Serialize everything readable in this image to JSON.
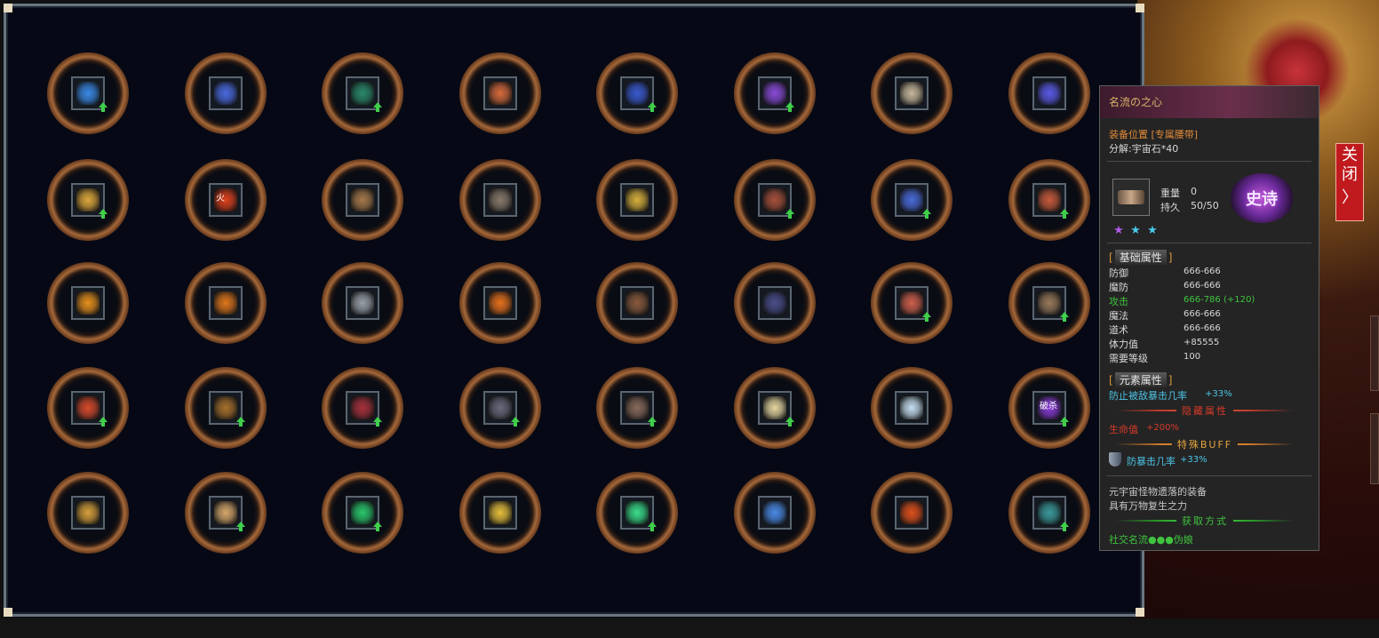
{
  "grid": {
    "columns": 8,
    "rows": 5,
    "slots": [
      {
        "icon": "blue-crystal-wings-icon",
        "color": "#3a8ae6",
        "up": true
      },
      {
        "icon": "blue-sword-icon",
        "color": "#4a6ae0",
        "up": false
      },
      {
        "icon": "green-dragon-icon",
        "color": "#2a8a6a",
        "up": true
      },
      {
        "icon": "fire-pouch-icon",
        "color": "#d86a3a",
        "up": false
      },
      {
        "icon": "blue-whip-icon",
        "color": "#3a5ad0",
        "up": true
      },
      {
        "icon": "purple-armor-icon",
        "color": "#8a4ad8",
        "up": true
      },
      {
        "icon": "scroll-icon",
        "color": "#c8b89a",
        "up": false
      },
      {
        "icon": "blue-ring-icon",
        "color": "#5a5ae6",
        "up": false
      },
      {
        "icon": "gold-tablet-icon",
        "color": "#e0a83a",
        "up": true
      },
      {
        "icon": "fire-orb-icon",
        "color": "#e0401a",
        "up": false
      },
      {
        "icon": "bone-axe-icon",
        "color": "#a87a4a",
        "up": false
      },
      {
        "icon": "dagger-icon",
        "color": "#8a7a6a",
        "up": false
      },
      {
        "icon": "golden-spear-icon",
        "color": "#d8b03a",
        "up": false
      },
      {
        "icon": "red-gun-icon",
        "color": "#a8503a",
        "up": true
      },
      {
        "icon": "blue-gem-boots-icon",
        "color": "#4a6ad8",
        "up": true
      },
      {
        "icon": "red-blade-icon",
        "color": "#c85a3a",
        "up": true
      },
      {
        "icon": "fire-frame-icon",
        "color": "#e8901a",
        "up": false
      },
      {
        "icon": "fire-beast-icon",
        "color": "#e0761a",
        "up": false
      },
      {
        "icon": "silver-staff-icon",
        "color": "#9aa0a8",
        "up": false
      },
      {
        "icon": "flame-square-icon",
        "color": "#e8701a",
        "up": false
      },
      {
        "icon": "helmet-icon",
        "color": "#8a5a3a",
        "up": false
      },
      {
        "icon": "dark-ring-icon",
        "color": "#4a4e8a",
        "up": false
      },
      {
        "icon": "rune-stone-icon",
        "color": "#d0604a",
        "up": true
      },
      {
        "icon": "brown-belt-icon",
        "color": "#9a7a5a",
        "up": true
      },
      {
        "icon": "red-rune-icon",
        "color": "#d84a2a",
        "up": true
      },
      {
        "icon": "bronze-gauntlet-icon",
        "color": "#a8702a",
        "up": true
      },
      {
        "icon": "red-claw-icon",
        "color": "#a8303a",
        "up": true
      },
      {
        "icon": "dark-beast-icon",
        "color": "#6a6a7a",
        "up": true
      },
      {
        "icon": "chain-belt-icon",
        "color": "#8a6a5a",
        "up": true
      },
      {
        "icon": "mask-icon",
        "color": "#e8d8a0",
        "up": true
      },
      {
        "icon": "crystal-icon",
        "color": "#c8e0f0",
        "up": false
      },
      {
        "icon": "purple-orb-icon",
        "color": "#8a3ad8",
        "up": true
      },
      {
        "icon": "gold-crest-icon",
        "color": "#d8a03a",
        "up": false
      },
      {
        "icon": "banner-icon",
        "color": "#d8a86a",
        "up": true
      },
      {
        "icon": "green-gourd-icon",
        "color": "#2ac86a",
        "up": true
      },
      {
        "icon": "gold-sword-icon",
        "color": "#e8c03a",
        "up": false
      },
      {
        "icon": "green-dragon-emblem-icon",
        "color": "#3ae08a",
        "up": true
      },
      {
        "icon": "lightning-spear-icon",
        "color": "#4a8ae6",
        "up": false
      },
      {
        "icon": "fire-gourd-icon",
        "color": "#e0501a",
        "up": false
      },
      {
        "icon": "teal-orb-icon",
        "color": "#3a9a9a",
        "up": true
      }
    ],
    "slot_text": {
      "9": "火",
      "31": "破杀"
    }
  },
  "tooltip": {
    "title": "名流の之心",
    "slot_line": "装备位置 [专属腰带]",
    "decompose_line": "分解:宇宙石*40",
    "weight_label": "重量",
    "weight_value": "0",
    "durability_label": "持久",
    "durability_value": "50/50",
    "badge": "史诗",
    "stars": [
      {
        "glyph": "★",
        "color": "#b05ae8"
      },
      {
        "glyph": "★",
        "color": "#4ac8e8"
      },
      {
        "glyph": "★",
        "color": "#4ac8e8"
      }
    ],
    "base_section": {
      "open": "[",
      "label": "基础属性",
      "close": "]"
    },
    "base_stats": [
      {
        "name": "防御",
        "value": "666-666",
        "color": "#d8d8d8"
      },
      {
        "name": "魔防",
        "value": "666-666",
        "color": "#d8d8d8"
      },
      {
        "name": "攻击",
        "value": "666-786 (+120)",
        "color": "#3fc43f"
      },
      {
        "name": "魔法",
        "value": "666-666",
        "color": "#d8d8d8"
      },
      {
        "name": "道术",
        "value": "666-666",
        "color": "#d8d8d8"
      },
      {
        "name": "体力值",
        "value": "+85555",
        "color": "#d8d8d8"
      },
      {
        "name": "需要等级",
        "value": "100",
        "color": "#d8d8d8"
      }
    ],
    "element_section": {
      "open": "[",
      "label": "元素属性",
      "close": "]"
    },
    "element_stat_name": "防止被敌暴击几率",
    "element_stat_value": "+33%",
    "hidden_divider": "隐藏属性",
    "hidden_stat_name": "生命值",
    "hidden_stat_value": "+200%",
    "buff_divider": "特殊BUFF",
    "buff_text": "防暴击几率",
    "buff_value": "+33%",
    "description": [
      "元宇宙怪物遗落的装备",
      "具有万物复生之力"
    ],
    "source_divider": "获取方式",
    "source_text": "社交名流●●●伪娘"
  },
  "close_button": {
    "line1": "关",
    "line2": "闭",
    "chevron": "〉"
  },
  "colors": {
    "panel_bg": "#060915",
    "tooltip_title": "#d7b26a",
    "green": "#3fc43f",
    "red": "#d83a2a",
    "close_red": "#c01a1e"
  }
}
